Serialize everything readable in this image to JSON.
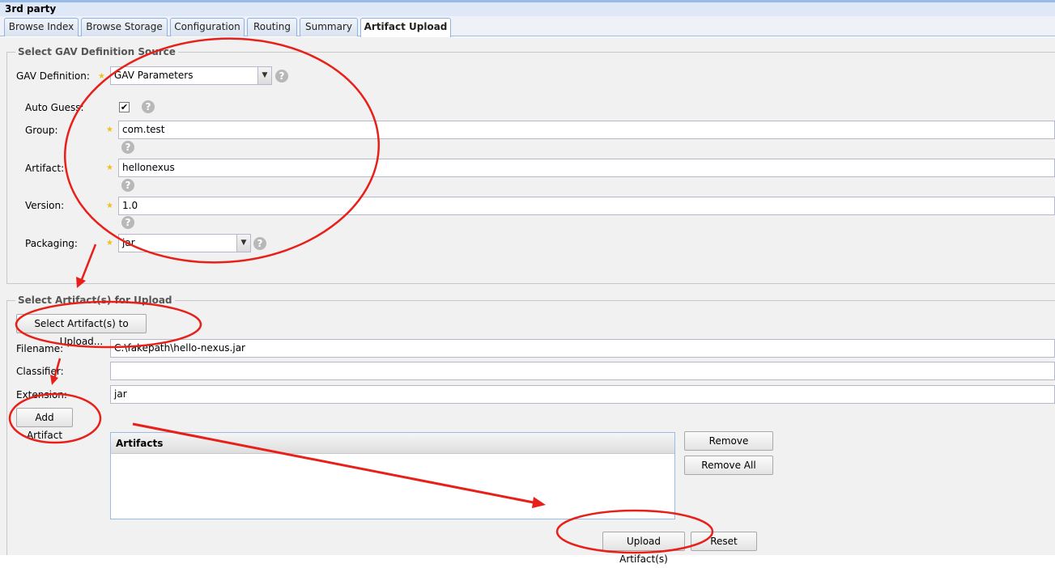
{
  "window": {
    "title": "3rd party"
  },
  "tabs": [
    {
      "label": "Browse Index"
    },
    {
      "label": "Browse Storage"
    },
    {
      "label": "Configuration"
    },
    {
      "label": "Routing"
    },
    {
      "label": "Summary"
    },
    {
      "label": "Artifact Upload",
      "active": true
    }
  ],
  "gav_section": {
    "legend": "Select GAV Definition Source",
    "gav_definition": {
      "label": "GAV Definition:",
      "value": "GAV Parameters"
    },
    "auto_guess": {
      "label": "Auto Guess:",
      "checked": true,
      "check_glyph": "✔"
    },
    "group": {
      "label": "Group:",
      "value": "com.test"
    },
    "artifact": {
      "label": "Artifact:",
      "value": "hellonexus"
    },
    "version": {
      "label": "Version:",
      "value": "1.0"
    },
    "packaging": {
      "label": "Packaging:",
      "value": "jar"
    }
  },
  "upload_section": {
    "legend": "Select Artifact(s) for Upload",
    "select_button": "Select Artifact(s) to Upload...",
    "filename": {
      "label": "Filename:",
      "value": "C:\\fakepath\\hello-nexus.jar"
    },
    "classifier": {
      "label": "Classifier:",
      "value": ""
    },
    "extension": {
      "label": "Extension:",
      "value": "jar"
    },
    "add_button": "Add Artifact",
    "artifacts_grid": {
      "header": "Artifacts",
      "rows": []
    },
    "remove_button": "Remove",
    "remove_all_button": "Remove All",
    "upload_button": "Upload Artifact(s)",
    "reset_button": "Reset"
  },
  "icons": {
    "required": "required-star-icon",
    "help": "help-question-icon",
    "help_glyph": "?",
    "dropdown_glyph": "▼",
    "required_glyph": "★"
  },
  "annotation_color": "#e8201a"
}
